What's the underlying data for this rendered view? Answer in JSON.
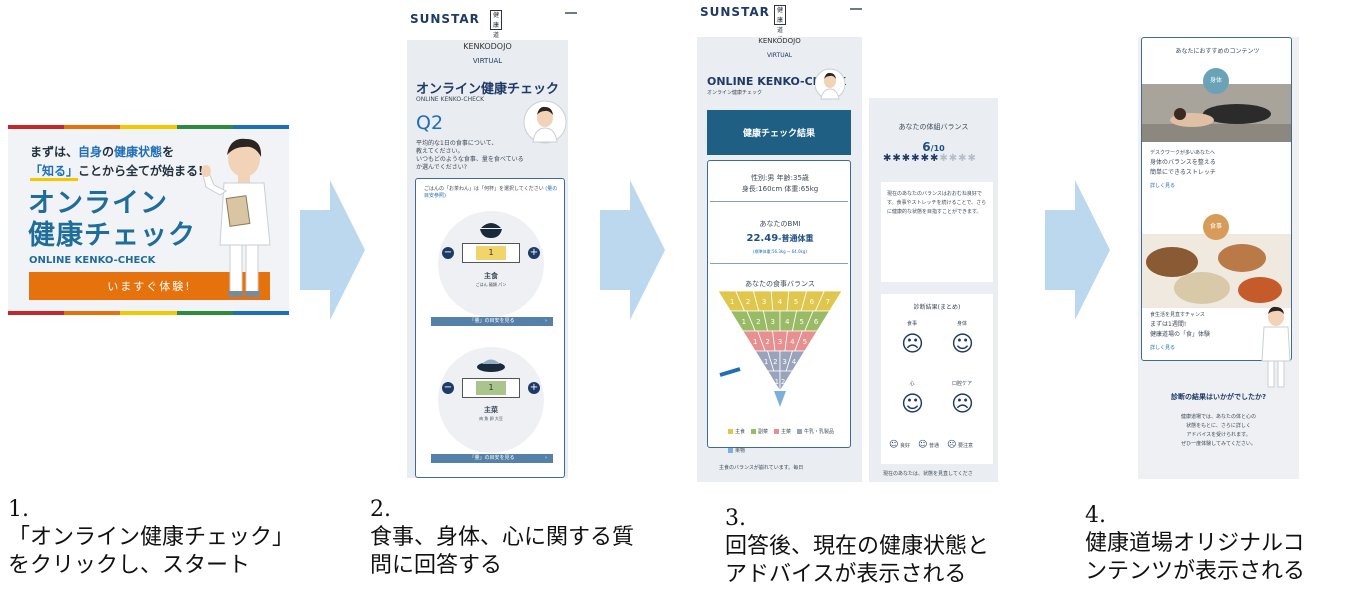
{
  "banner": {
    "intro_plain": "まずは、",
    "intro_highlight_1": "自身",
    "intro_mid": "の",
    "intro_highlight_2": "健康状態",
    "intro_end": "を",
    "intro_box": "「知る」",
    "intro_tail": "ことから全てが始まる!",
    "title_line1": "オンライン",
    "title_line2": "健康チェック",
    "subtitle": "ONLINE KENKO-CHECK",
    "cta_label": "いますぐ体験!",
    "cta_chevron": "›",
    "rail_colors": [
      "#c62828",
      "#e5720c",
      "#f3c800",
      "#2e8b3e",
      "#1f6fb8"
    ]
  },
  "phone2": {
    "brand": "SUNSTAR",
    "seal": "健康道場",
    "logo_kenkodojo": "KENKODOJO",
    "logo_virtual": "VIRTUAL",
    "title": "オンライン健康チェック",
    "subtitle": "ONLINE KENKO-CHECK",
    "question_no": "Q2",
    "question_text_1": "平均的な1日の食事について、",
    "question_text_2": "教えてください。",
    "question_text_3": "いつもどのような食事、量を食べているか選んでください?",
    "card_instruction": "ごはんの「お茶わん」は「何杯」を選択してください",
    "card_link": "(量の目安参照)",
    "item1_value": "1",
    "item1_name": "主食",
    "item1_sub": "ごはん 麺類 パン",
    "item1_bar": "「量」の目安を見る",
    "item2_value": "1",
    "item2_name": "主菜",
    "item2_sub": "肉 魚 卵 大豆",
    "item2_bar": "「量」の目安を見る",
    "bar_chevron": "›"
  },
  "phone3": {
    "brand": "SUNSTAR",
    "seal": "健康道場",
    "logo_kenkodojo": "KENKODOJO",
    "logo_virtual": "VIRTUAL",
    "title": "ONLINE KENKO-CHECK",
    "title_sub": "オンライン健康チェック",
    "result_button": "健康チェック結果",
    "profile_line1": "性別:男 年齢:35歳",
    "profile_line2": "身長:160cm 体重:65kg",
    "bmi_label": "あなたのBMI",
    "bmi_value": "22.49",
    "bmi_status": "-普通体重",
    "bmi_range": "(標準体重:56.3kg ~ 64.0kg)",
    "diet_label": "あなたの食事バランス",
    "pyramid_rows": [
      [
        "1",
        "2",
        "3",
        "4",
        "5",
        "6",
        "7"
      ],
      [
        "1",
        "2",
        "3",
        "4",
        "5",
        "6"
      ],
      [
        "1",
        "2",
        "3",
        "4",
        "5"
      ],
      [
        "1",
        "2",
        "3",
        "4"
      ],
      [
        "1",
        "2"
      ]
    ],
    "pyramid_colors": [
      "#e0c64c",
      "#99bb66",
      "#e88f8f",
      "#9aa3bb"
    ],
    "legend": [
      {
        "label": "主食",
        "color": "#e0c64c"
      },
      {
        "label": "副菜",
        "color": "#99bb66"
      },
      {
        "label": "主菜",
        "color": "#e88f8f"
      },
      {
        "label": "牛乳・乳製品",
        "color": "#9aa3bb"
      },
      {
        "label": "果物",
        "color": "#7bb0d8"
      }
    ],
    "footer_text": "主食のバランスが崩れています。毎日",
    "balance_label": "あなたの体組バランス",
    "balance_score": "6",
    "balance_total": "/10",
    "advice_text": "現在のあなたのバランスはおおむね良好です。食事やストレッチを続けることで、さらに健康的な状態を目指すことができます。",
    "summary_label": "診断結果(まとめ)",
    "summary_items": [
      {
        "label": "食事",
        "sub": ""
      },
      {
        "label": "身体",
        "sub": ""
      },
      {
        "label": "心",
        "sub": ""
      },
      {
        "label": "口腔ケア",
        "sub": ""
      }
    ],
    "status_legend": [
      "良好",
      "普通",
      "要注意"
    ],
    "bottom_text": "現在のあなたは、状態を見直してくださ"
  },
  "phone4": {
    "section_label": "あなたにおすすめのコンテンツ",
    "tag1": "身体",
    "item1_line1": "デスクワークが多いあなたへ",
    "item1_line2": "身体のバランスを整える",
    "item1_line3": "簡単にできるストレッチ",
    "more1": "詳しく見る",
    "tag2": "食事",
    "item2_line1": "食生活を見直すチャンス",
    "item2_line2": "まずは1週間!",
    "item2_line3": "健康道場の「食」体験",
    "more2": "詳しく見る",
    "question": "診断の結果はいかがでしたか?",
    "closing_1": "健康道場では、あなたの体と心の",
    "closing_2": "状態をもとに、さらに詳しく",
    "closing_3": "アドバイスを受けられます。",
    "closing_4": "ぜひ一度体験してみてください。"
  },
  "captions": [
    {
      "num": "1.",
      "line1": "「オンライン健康チェック」",
      "line2": "をクリックし、スタート"
    },
    {
      "num": "2.",
      "line1": "食事、身体、心に関する質",
      "line2": "問に回答する"
    },
    {
      "num": "3.",
      "line1": "回答後、現在の健康状態と",
      "line2": "アドバイスが表示される"
    },
    {
      "num": "4.",
      "line1": "健康道場オリジナルコ",
      "line2": "ンテンツが表示される"
    }
  ]
}
